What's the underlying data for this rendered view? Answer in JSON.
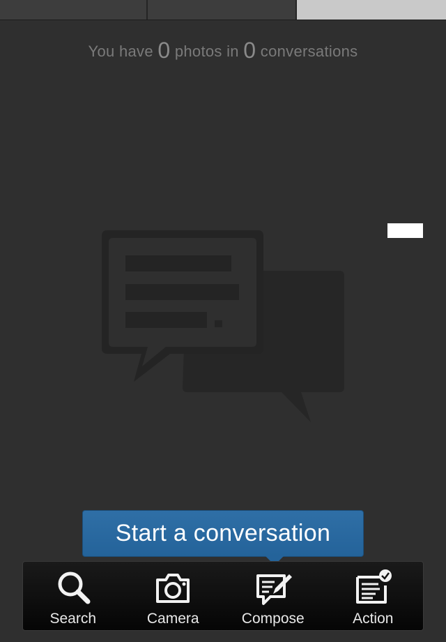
{
  "top_tabs": [
    {
      "name": "tab-1",
      "selected": false
    },
    {
      "name": "tab-2",
      "selected": false
    },
    {
      "name": "tab-3",
      "selected": true
    }
  ],
  "summary": {
    "prefix": "You have",
    "photos_count": "0",
    "middle": "photos in",
    "conversations_count": "0",
    "suffix": "conversations"
  },
  "illustration": {
    "icon": "chat-bubbles-icon"
  },
  "tooltip": {
    "label": "Start a conversation"
  },
  "bottom_bar": {
    "items": [
      {
        "label": "Search",
        "icon": "search-icon"
      },
      {
        "label": "Camera",
        "icon": "camera-icon"
      },
      {
        "label": "Compose",
        "icon": "compose-icon"
      },
      {
        "label": "Action",
        "icon": "action-icon"
      }
    ]
  },
  "colors": {
    "background": "#2f2f2f",
    "tooltip": "#24639a",
    "bar": "#0a0a0a",
    "selected_tab": "#c9c9c9"
  }
}
